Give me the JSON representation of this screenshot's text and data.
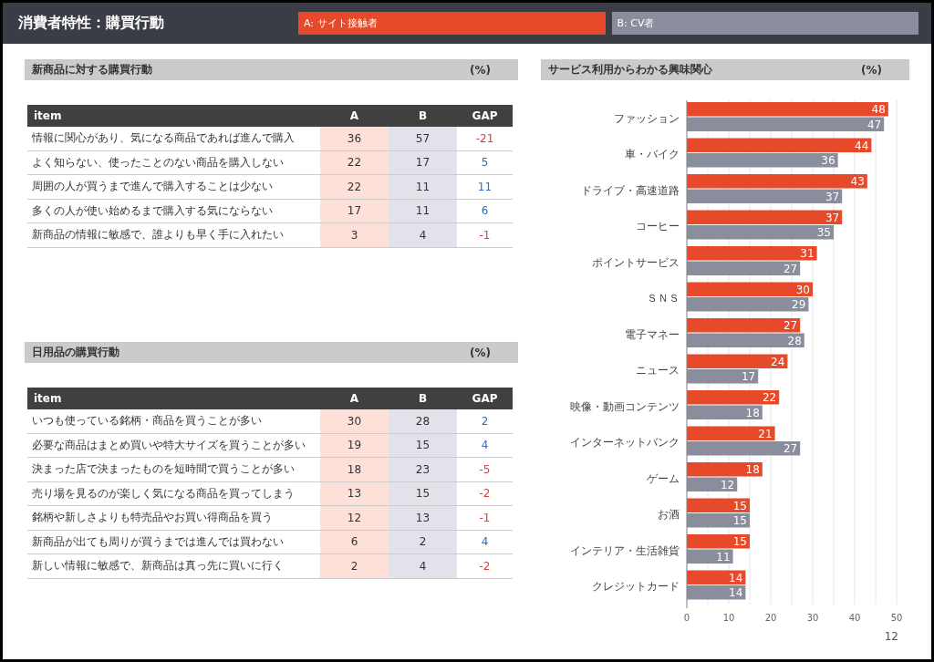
{
  "header": {
    "title": "消費者特性：購買行動"
  },
  "sections": [
    {
      "title": "新商品に対する購買行動",
      "unit": "(%)",
      "columns": [
        "item",
        "A",
        "B",
        "GAP"
      ],
      "rows": [
        {
          "item": "情報に関心があり、気になる商品であれば進んで購入",
          "a": "36",
          "b": "57",
          "gap": "-21",
          "kind": "negative"
        },
        {
          "item": "よく知らない、使ったことのない商品を購入しない",
          "a": "22",
          "b": "17",
          "gap": "5",
          "kind": "positive"
        },
        {
          "item": "周囲の人が買うまで進んで購入することは少ない",
          "a": "22",
          "b": "11",
          "gap": "11",
          "kind": "positive"
        },
        {
          "item": "多くの人が使い始めるまで購入する気にならない",
          "a": "17",
          "b": "11",
          "gap": "6",
          "kind": "positive"
        },
        {
          "item": "新商品の情報に敏感で、誰よりも早く手に入れたい",
          "a": "3",
          "b": "4",
          "gap": "-1",
          "kind": "negative"
        }
      ]
    },
    {
      "title": "日用品の購買行動",
      "unit": "(%)",
      "columns": [
        "item",
        "A",
        "B",
        "GAP"
      ],
      "rows": [
        {
          "item": "いつも使っている銘柄・商品を買うことが多い",
          "a": "30",
          "b": "28",
          "gap": "2",
          "kind": "positive"
        },
        {
          "item": "必要な商品はまとめ買いや特大サイズを買うことが多い",
          "a": "19",
          "b": "15",
          "gap": "4",
          "kind": "positive"
        },
        {
          "item": "決まった店で決まったものを短時間で買うことが多い",
          "a": "18",
          "b": "23",
          "gap": "-5",
          "kind": "negative"
        },
        {
          "item": "売り場を見るのが楽しく気になる商品を買ってしまう",
          "a": "13",
          "b": "15",
          "gap": "-2",
          "kind": "negative"
        },
        {
          "item": "銘柄や新しさよりも特売品やお買い得商品を買う",
          "a": "12",
          "b": "13",
          "gap": "-1",
          "kind": "negative"
        },
        {
          "item": "新商品が出ても周りが買うまでは進んでは買わない",
          "a": "6",
          "b": "2",
          "gap": "4",
          "kind": "positive"
        },
        {
          "item": "新しい情報に敏感で、新商品は真っ先に買いに行く",
          "a": "2",
          "b": "4",
          "gap": "-2",
          "kind": "negative"
        }
      ]
    }
  ],
  "interests": {
    "title": "サービス利用からわかる興味関心",
    "unit": "(%)",
    "chart_data": {
      "type": "bar",
      "orientation": "horizontal",
      "data_labels": true,
      "grid": true,
      "categories": [
        "ファッション",
        "車・バイク",
        "ドライブ・高速道路",
        "コーヒー",
        "ポイントサービス",
        "ＳＮＳ",
        "電子マネー",
        "ニュース",
        "映像・動画コンテンツ",
        "インターネットバンク",
        "ゲーム",
        "お酒",
        "インテリア・生活雑貨",
        "クレジットカード"
      ],
      "series": [
        {
          "name": "A: サイト接触者",
          "color": "#e64a2a",
          "values": [
            48,
            44,
            43,
            37,
            31,
            30,
            27,
            24,
            22,
            21,
            18,
            15,
            15,
            14
          ]
        },
        {
          "name": "B: CV者",
          "color": "#8a8d9b",
          "values": [
            47,
            36,
            37,
            35,
            27,
            29,
            28,
            17,
            18,
            27,
            12,
            15,
            11,
            14
          ]
        }
      ],
      "xlim": [
        0,
        50
      ],
      "xticks": [
        0,
        10,
        20,
        30,
        40,
        50
      ]
    }
  },
  "page_number": "12"
}
